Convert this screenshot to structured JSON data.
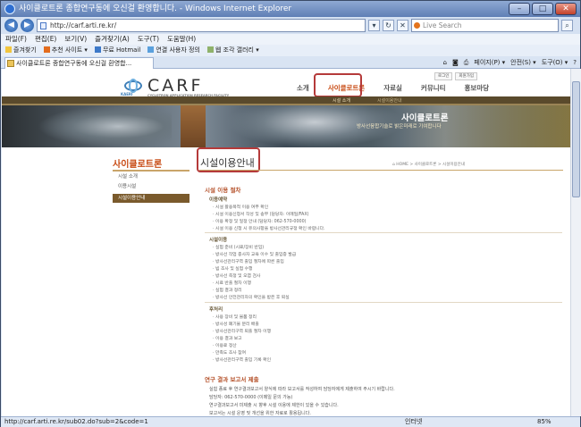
{
  "window": {
    "title": "사이클로트론 종합연구동에 오신걸 환영합니다. - Windows Internet Explorer"
  },
  "address_bar": {
    "url": "http://carf.arti.re.kr/",
    "search_placeholder": "Live Search"
  },
  "menu": [
    "파일(F)",
    "편집(E)",
    "보기(V)",
    "즐겨찾기(A)",
    "도구(T)",
    "도움말(H)"
  ],
  "favorites": {
    "label": "즐겨찾기",
    "items": [
      "추천 사이트 ▾",
      "무료 Hotmail",
      "연결 사용자 정의",
      "웹 조각 갤러리 ▾"
    ]
  },
  "tab": {
    "title": "사이클로트론 종합연구동에 오신걸 환영합...",
    "tools": [
      "페이지(P) ▾",
      "안전(S) ▾",
      "도구(O) ▾"
    ]
  },
  "site": {
    "logo": "CARF",
    "logo_org": "KAERI",
    "logo_sub": "CYCLOTRON APPLICATION RESEARCH FACILITY",
    "util": [
      "로그인",
      "회원가입"
    ],
    "gnb": [
      "소개",
      "사이클로트론",
      "자료실",
      "커뮤니티",
      "홍보마당"
    ],
    "subnav": [
      "시설 소개",
      "시설이용안내"
    ],
    "banner_title": "사이클로트론",
    "banner_subtitle": "방사선융합기술로 밝은미래로 기여합니다",
    "lnb_title": "사이클로트론",
    "lnb_items": [
      "시설 소개",
      "이용시설",
      "시설이용안내"
    ],
    "page_title": "시설이용안내",
    "breadcrumb": "⌂ HOME > 사이클로트론 > 시설이용안내",
    "sections": {
      "s1": "시설 이용 절차",
      "s1a": "이용예약",
      "s1a_lines": [
        "· 시설 활용목적 이용 여부 확인",
        "· 시설 이용신청서 작성 및 송부 (담당자: 이메일/FAX)",
        "· 이용 확정 및 일정 안내 (담당자: 062-570-0000)",
        "· 시설 이용 신청 시 유의사항을 방사선관리규정 확인 바랍니다."
      ],
      "s1b": "시설이용",
      "s1b_lines": [
        "· 실험 준비 (시료/장비 반입)",
        "· 방사선 작업 종사자 교육 이수 및 출입증 발급",
        "· 방사선관리구역 출입 절차에 따른 출입",
        "· 빔 조사 및 실험 수행",
        "· 방사선 측정 및 오염 검사",
        "· 시료 반출 절차 이행",
        "· 실험 결과 정리",
        "· 방사선 안전관리자의 확인을 받은 후 퇴실"
      ],
      "s1c": "후처리",
      "s1c_lines": [
        "· 사용 장비 및 물품 정리",
        "· 방사성 폐기물 분리 배출",
        "· 방사선관리구역 퇴출 절차 이행",
        "· 이용 결과 보고",
        "· 이용료 정산",
        "· 만족도 조사 참여",
        "· 방사선관리구역 출입 기록 확인"
      ],
      "s2": "연구 결과 보고서 제출",
      "s2_lines": [
        "실험 종료 후 연구결과보고서 양식에 따라 보고서를 작성하여 담당자에게 제출하여 주시기 바랍니다.",
        "담당자: 062-570-0000 (이메일 문의 가능)",
        "연구결과보고서 미제출 시 향후 시설 이용에 제한이 있을 수 있습니다.",
        "보고서는 시설 운영 및 개선을 위한 자료로 활용됩니다."
      ]
    }
  },
  "status": {
    "url": "http://carf.arti.re.kr/sub02.do?sub=2&code=1",
    "zone": "인터넷",
    "zoom": "85%"
  }
}
